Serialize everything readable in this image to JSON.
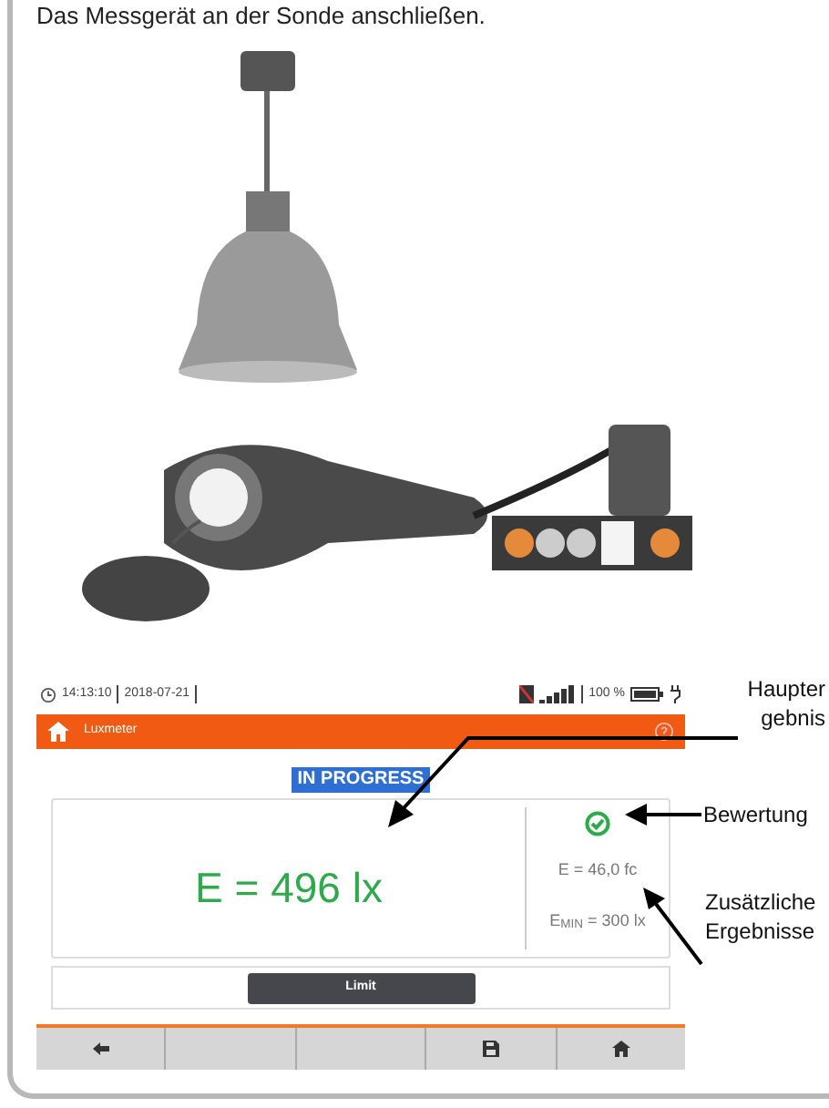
{
  "caption": "Das Messgerät an der Sonde anschließen.",
  "device_screen": {
    "status_bar": {
      "time": "14:13:10",
      "date": "2018-07-21",
      "battery": "100 %"
    },
    "header": {
      "title": "Luxmeter"
    },
    "badge": "IN PROGRESS",
    "result": {
      "main": "E = 496 lx",
      "passed": true,
      "secondary": [
        "E = 46,0 fc",
        "E$_{MIN}$ = 300 lx"
      ]
    },
    "limit_button": "Limit",
    "toolbar": [
      {
        "kind": "back"
      },
      {
        "kind": "empty"
      },
      {
        "kind": "empty"
      },
      {
        "kind": "save"
      },
      {
        "kind": "home"
      }
    ]
  },
  "annotations": [
    {
      "lines": [
        "Haupter",
        "gebnis"
      ]
    },
    {
      "lines": [
        "Bewertung"
      ]
    },
    {
      "lines": [
        "Zusätzliche",
        "Ergebnisse"
      ]
    }
  ]
}
